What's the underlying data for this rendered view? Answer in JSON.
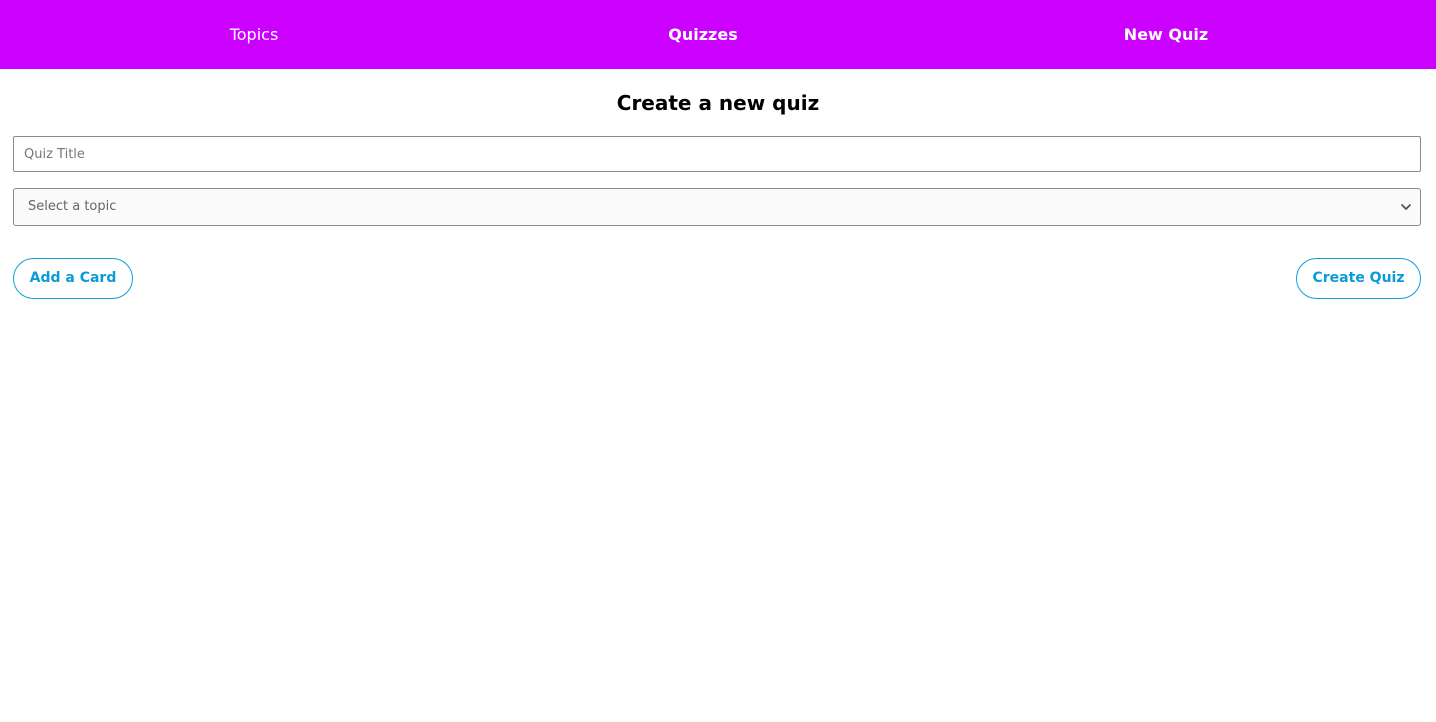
{
  "nav": {
    "topics_label": "Topics",
    "quizzes_label": "Quizzes",
    "new_quiz_label": "New Quiz"
  },
  "page": {
    "title": "Create a new quiz"
  },
  "form": {
    "quiz_title_placeholder": "Quiz Title",
    "quiz_title_value": "",
    "topic_select_value": "Select a topic",
    "add_card_label": "Add a Card",
    "create_quiz_label": "Create Quiz"
  },
  "icons": {
    "select_arrow": "chevron-down-icon"
  },
  "colors": {
    "nav_background": "#cc00ff",
    "nav_text": "#ffffff",
    "button_accent": "#0a9bd8"
  }
}
